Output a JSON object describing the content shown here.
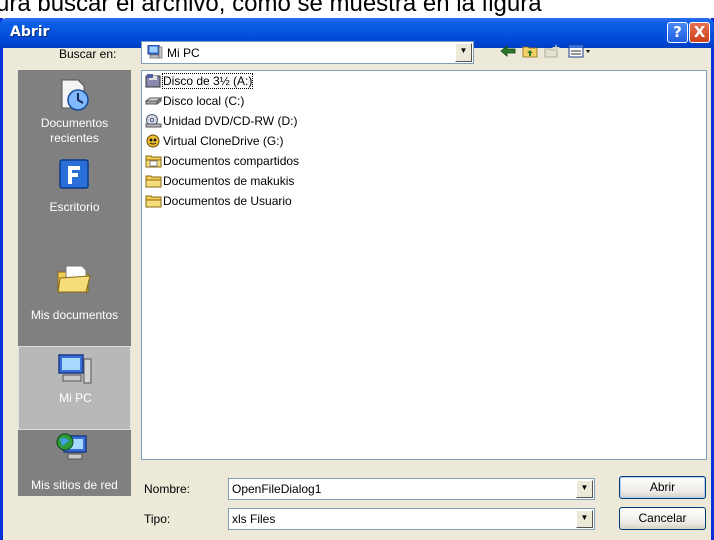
{
  "document_caption": "ura buscar el archivo, como se muestra en la figura",
  "window": {
    "title": "Abrir",
    "help_glyph": "?",
    "close_glyph": "X"
  },
  "lookin": {
    "label": "Buscar en:",
    "value": "Mi PC",
    "icon": "my-computer-icon"
  },
  "toolbar": {
    "back_icon": "back-arrow-icon",
    "up_icon": "up-folder-icon",
    "new_folder_icon": "new-folder-icon",
    "view_icon": "view-menu-icon"
  },
  "places": [
    {
      "label": "Documentos recientes",
      "icon": "recent-documents-icon"
    },
    {
      "label": "Escritorio",
      "icon": "desktop-icon"
    },
    {
      "label": "Mis documentos",
      "icon": "my-documents-icon"
    },
    {
      "label": "Mi PC",
      "icon": "my-computer-icon",
      "selected": true
    },
    {
      "label": "Mis sitios de red",
      "icon": "network-places-icon"
    }
  ],
  "files": [
    {
      "name": "Disco de 3½ (A:)",
      "icon": "floppy-drive-icon"
    },
    {
      "name": "Disco local (C:)",
      "icon": "hard-disk-icon"
    },
    {
      "name": "Unidad DVD/CD-RW (D:)",
      "icon": "dvd-drive-icon"
    },
    {
      "name": "Virtual CloneDrive (G:)",
      "icon": "virtual-drive-icon"
    },
    {
      "name": "Documentos compartidos",
      "icon": "shared-folder-icon"
    },
    {
      "name": "Documentos de makukis",
      "icon": "folder-icon"
    },
    {
      "name": "Documentos de Usuario",
      "icon": "folder-icon"
    }
  ],
  "filename": {
    "label": "Nombre:",
    "value": "OpenFileDialog1"
  },
  "filetype": {
    "label": "Tipo:",
    "value": "xls Files"
  },
  "buttons": {
    "open": "Abrir",
    "cancel": "Cancelar"
  }
}
